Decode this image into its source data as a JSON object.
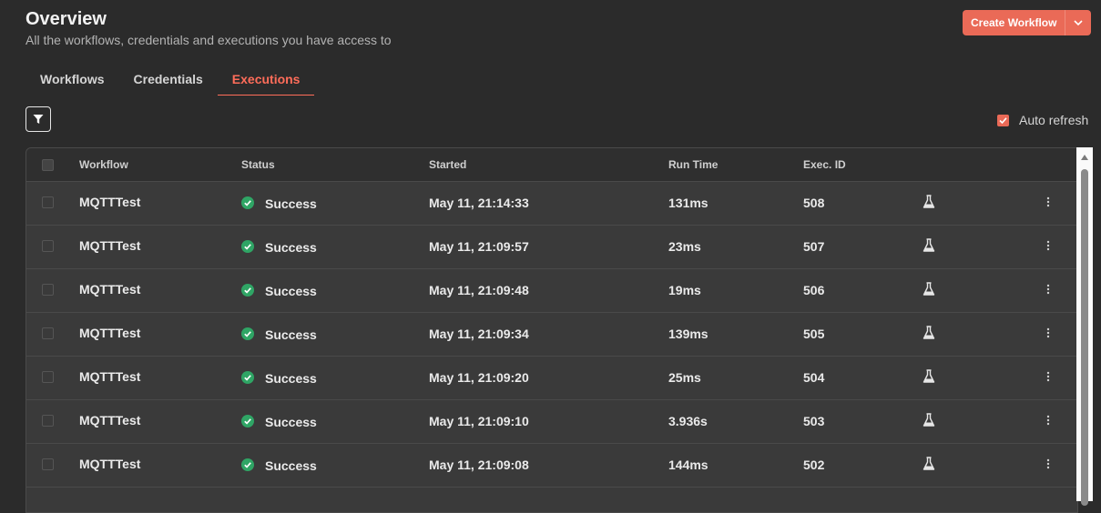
{
  "header": {
    "title": "Overview",
    "subtitle": "All the workflows, credentials and executions you have access to",
    "create_label": "Create Workflow"
  },
  "tabs": [
    {
      "label": "Workflows",
      "active": false
    },
    {
      "label": "Credentials",
      "active": false
    },
    {
      "label": "Executions",
      "active": true
    }
  ],
  "toolbar": {
    "filter_icon": "filter-icon",
    "auto_refresh_label": "Auto refresh",
    "auto_refresh_checked": true
  },
  "table": {
    "columns": [
      "Workflow",
      "Status",
      "Started",
      "Run Time",
      "Exec. ID"
    ],
    "rows": [
      {
        "workflow": "MQTTTest",
        "status": "Success",
        "started": "May 11, 21:14:33",
        "run_time": "131ms",
        "exec_id": "508"
      },
      {
        "workflow": "MQTTTest",
        "status": "Success",
        "started": "May 11, 21:09:57",
        "run_time": "23ms",
        "exec_id": "507"
      },
      {
        "workflow": "MQTTTest",
        "status": "Success",
        "started": "May 11, 21:09:48",
        "run_time": "19ms",
        "exec_id": "506"
      },
      {
        "workflow": "MQTTTest",
        "status": "Success",
        "started": "May 11, 21:09:34",
        "run_time": "139ms",
        "exec_id": "505"
      },
      {
        "workflow": "MQTTTest",
        "status": "Success",
        "started": "May 11, 21:09:20",
        "run_time": "25ms",
        "exec_id": "504"
      },
      {
        "workflow": "MQTTTest",
        "status": "Success",
        "started": "May 11, 21:09:10",
        "run_time": "3.936s",
        "exec_id": "503"
      },
      {
        "workflow": "MQTTTest",
        "status": "Success",
        "started": "May 11, 21:09:08",
        "run_time": "144ms",
        "exec_id": "502"
      }
    ]
  },
  "colors": {
    "accent": "#ff6d5a",
    "success": "#2fa565"
  }
}
